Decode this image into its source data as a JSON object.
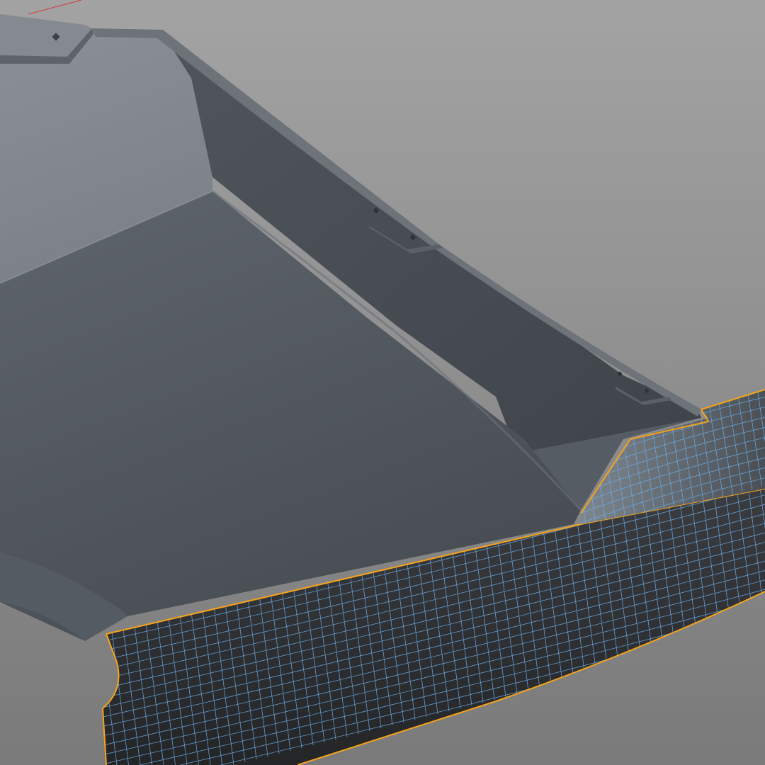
{
  "viewport": {
    "background_top": "#a3a3a3",
    "background_bottom": "#7a7a7a"
  },
  "colors": {
    "body_light": "#8f959b",
    "body_mid": "#5b6168",
    "body_dark": "#474c53",
    "rim_edge": "#6d7379",
    "wire_fill": "#2b2c2e",
    "wire_line": "#6faee8",
    "selection_outline": "#f5a31a",
    "axis_x": "#d03c3c"
  },
  "scene": {
    "upper_part": {
      "label": "",
      "wireframe": false
    },
    "lower_part": {
      "label": "",
      "wireframe": true,
      "selected": true
    }
  }
}
